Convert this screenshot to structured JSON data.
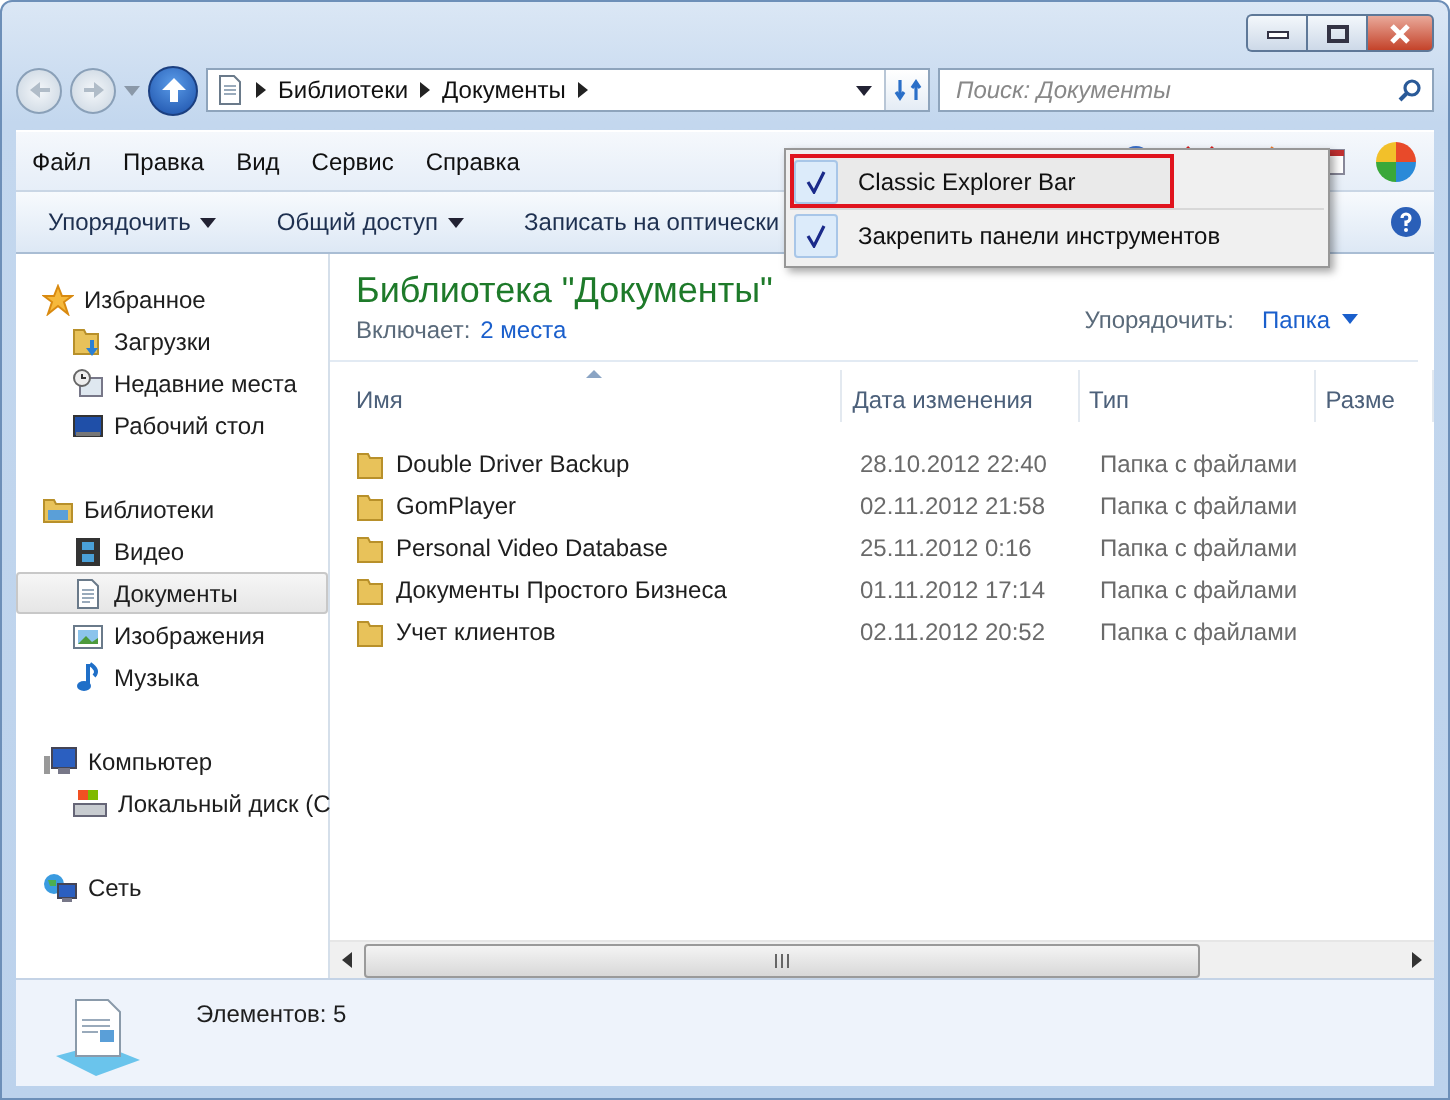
{
  "address": {
    "crumbs": [
      "Библиотеки",
      "Документы"
    ]
  },
  "search": {
    "placeholder": "Поиск: Документы"
  },
  "menu": [
    "Файл",
    "Правка",
    "Вид",
    "Сервис",
    "Справка"
  ],
  "commands": [
    {
      "label": "Упорядочить",
      "dropdown": true
    },
    {
      "label": "Общий доступ",
      "dropdown": true
    },
    {
      "label": "Записать на оптически",
      "dropdown": false
    }
  ],
  "context_menu": {
    "items": [
      {
        "label": "Classic Explorer Bar",
        "checked": true,
        "highlighted": true
      },
      {
        "label": "Закрепить панели инструментов",
        "checked": true,
        "highlighted": false
      }
    ]
  },
  "sidebar": {
    "groups": [
      {
        "label": "Избранное",
        "children": [
          {
            "label": "Загрузки",
            "selected": false
          },
          {
            "label": "Недавние места",
            "selected": false
          },
          {
            "label": "Рабочий стол",
            "selected": false
          }
        ]
      },
      {
        "label": "Библиотеки",
        "children": [
          {
            "label": "Видео",
            "selected": false
          },
          {
            "label": "Документы",
            "selected": true
          },
          {
            "label": "Изображения",
            "selected": false
          },
          {
            "label": "Музыка",
            "selected": false
          }
        ]
      },
      {
        "label": "Компьютер",
        "children": [
          {
            "label": "Локальный диск (C",
            "selected": false
          }
        ]
      },
      {
        "label": "Сеть"
      }
    ]
  },
  "library": {
    "title": "Библиотека \"Документы\"",
    "includes_label": "Включает:",
    "includes_link": "2 места",
    "arrange_label": "Упорядочить:",
    "arrange_value": "Папка"
  },
  "table": {
    "columns": [
      {
        "label": "Имя",
        "sorted": true
      },
      {
        "label": "Дата изменения",
        "sorted": false
      },
      {
        "label": "Тип",
        "sorted": false
      },
      {
        "label": "Разме",
        "sorted": false
      }
    ],
    "rows": [
      {
        "name": "Double Driver Backup",
        "date": "28.10.2012 22:40",
        "type": "Папка с файлами"
      },
      {
        "name": "GomPlayer",
        "date": "02.11.2012 21:58",
        "type": "Папка с файлами"
      },
      {
        "name": "Personal Video Database",
        "date": "25.11.2012 0:16",
        "type": "Папка с файлами"
      },
      {
        "name": "Документы Простого Бизнеса",
        "date": "01.11.2012 17:14",
        "type": "Папка с файлами"
      },
      {
        "name": "Учет клиентов",
        "date": "02.11.2012 20:52",
        "type": "Папка с файлами"
      }
    ]
  },
  "status_bar": {
    "text": "Элементов: 5"
  }
}
